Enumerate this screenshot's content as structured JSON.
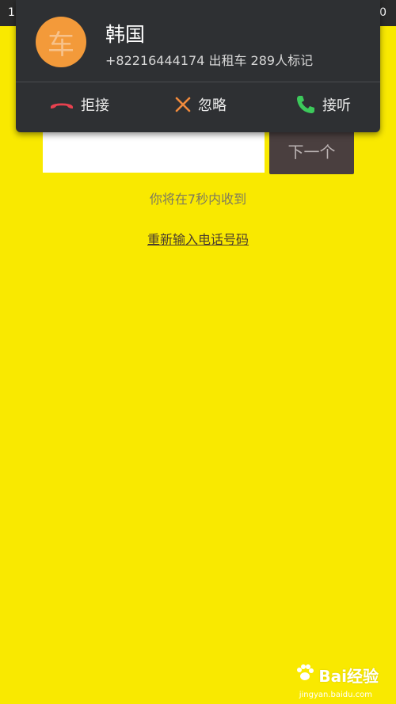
{
  "status_bar": {
    "time": "1",
    "right": "0"
  },
  "screen": {
    "next_button_label": "下一个",
    "hint_text": "你将在7秒内收到",
    "reenter_link": "重新输入电话号码"
  },
  "call_notification": {
    "avatar_char": "车",
    "caller_name": "韩国",
    "caller_detail": "+82216444174 出租车 289人标记",
    "actions": {
      "decline": "拒接",
      "ignore": "忽略",
      "answer": "接听"
    },
    "colors": {
      "decline": "#e8414f",
      "ignore": "#f08a3c",
      "answer": "#3cc95b"
    }
  },
  "watermark": {
    "brand": "Bai经验",
    "url": "jingyan.baidu.com"
  }
}
